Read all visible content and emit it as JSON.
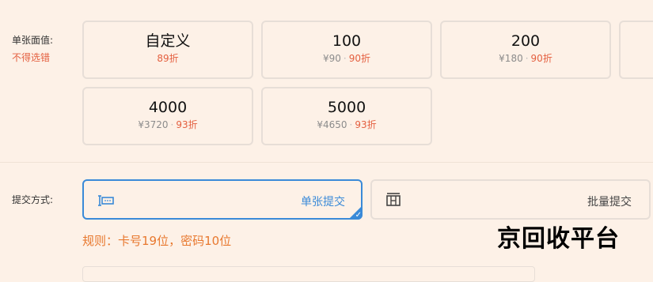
{
  "face_value": {
    "label": "单张面值:",
    "warning": "不得选错",
    "cards": [
      {
        "title": "自定义",
        "discount": "89折"
      },
      {
        "title": "100",
        "price": "¥90",
        "discount": "90折"
      },
      {
        "title": "200",
        "price": "¥180",
        "discount": "90折"
      },
      {
        "title": "4000",
        "price": "¥3720",
        "discount": "93折"
      },
      {
        "title": "5000",
        "price": "¥4650",
        "discount": "93折"
      }
    ]
  },
  "submit_method": {
    "label": "提交方式:",
    "options": [
      {
        "label": "单张提交",
        "selected": true,
        "icon": "single-card-icon"
      },
      {
        "label": "批量提交",
        "selected": false,
        "icon": "batch-card-icon"
      }
    ]
  },
  "rule": "规则：卡号19位，密码10位",
  "watermark": "京回收平台",
  "dot": "·",
  "colors": {
    "accent": "#3a8ad8",
    "discount": "#e45f3f",
    "rule": "#e8782e",
    "background": "#fdf1e7"
  }
}
